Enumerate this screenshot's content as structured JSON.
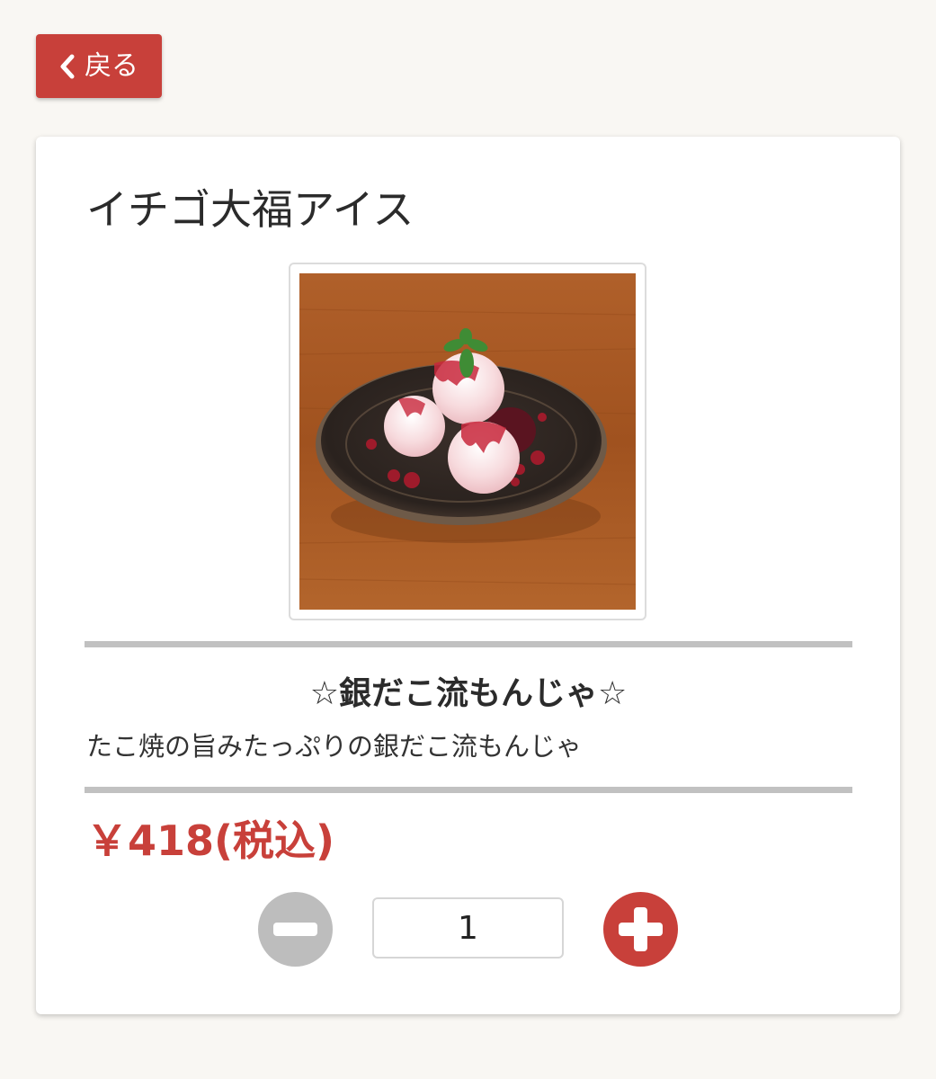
{
  "header": {
    "back_label": "戻る",
    "back_icon": "chevron-left-icon"
  },
  "product": {
    "name": "イチゴ大福アイス",
    "image_alt": "イチゴ大福アイス",
    "catchphrase": "☆銀だこ流もんじゃ☆",
    "description": "たこ焼の旨みたっぷりの銀だこ流もんじゃ",
    "price": "￥418(税込)"
  },
  "quantity": {
    "value": "1",
    "minus_icon": "minus-circle-icon",
    "plus_icon": "plus-circle-icon"
  },
  "colors": {
    "accent": "#c8403a",
    "disabled": "#bdbdbd",
    "background": "#f9f7f3"
  }
}
